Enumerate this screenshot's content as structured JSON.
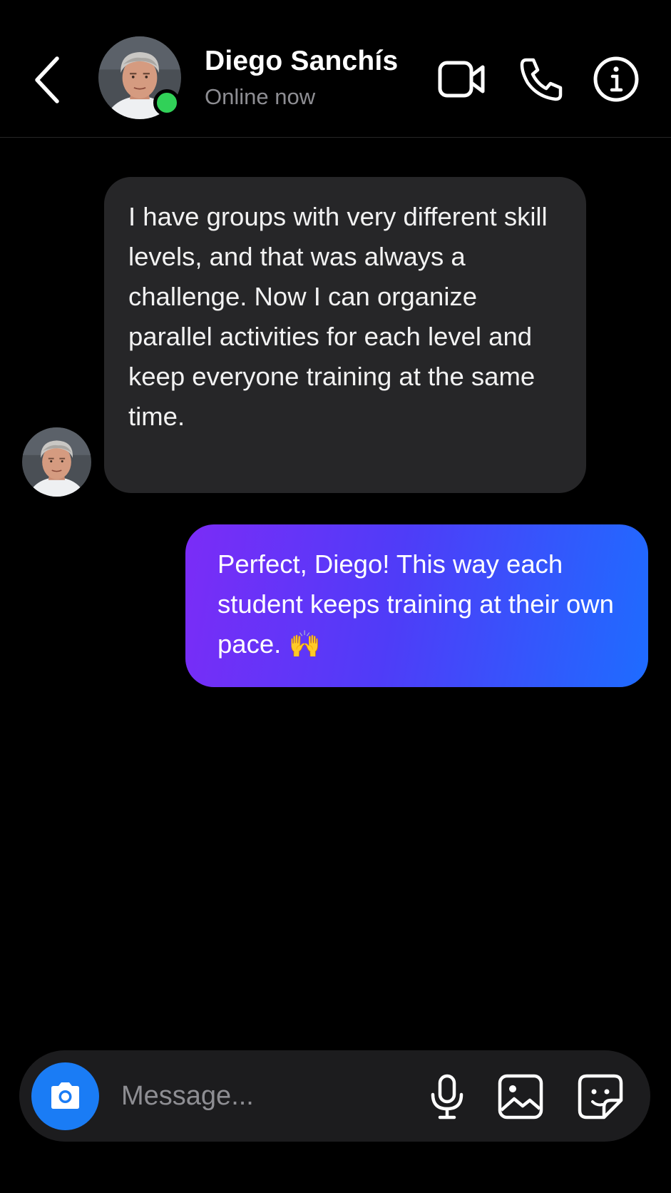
{
  "header": {
    "contact_name": "Diego Sanchís",
    "status": "Online now",
    "icons": {
      "back": "chevron-left-icon",
      "video": "video-camera-icon",
      "call": "phone-icon",
      "info": "info-icon"
    }
  },
  "messages": [
    {
      "direction": "incoming",
      "text": "I have groups with very different skill levels, and that was always a challenge. Now I can organize parallel activities for each level and keep everyone training at the same time."
    },
    {
      "direction": "outgoing",
      "text": "Perfect, Diego! This way each student keeps training at their own pace.",
      "emoji": "🙌"
    }
  ],
  "composer": {
    "placeholder": "Message...",
    "icons": [
      "camera-icon",
      "microphone-icon",
      "gallery-icon",
      "sticker-icon"
    ]
  },
  "colors": {
    "background": "#000000",
    "incoming_bubble": "#262628",
    "outgoing_gradient_start": "#7b2cf7",
    "outgoing_gradient_end": "#1e6cff",
    "online_indicator": "#31d158",
    "camera_button": "#1a7cf5",
    "secondary_text": "#8e8e93"
  }
}
